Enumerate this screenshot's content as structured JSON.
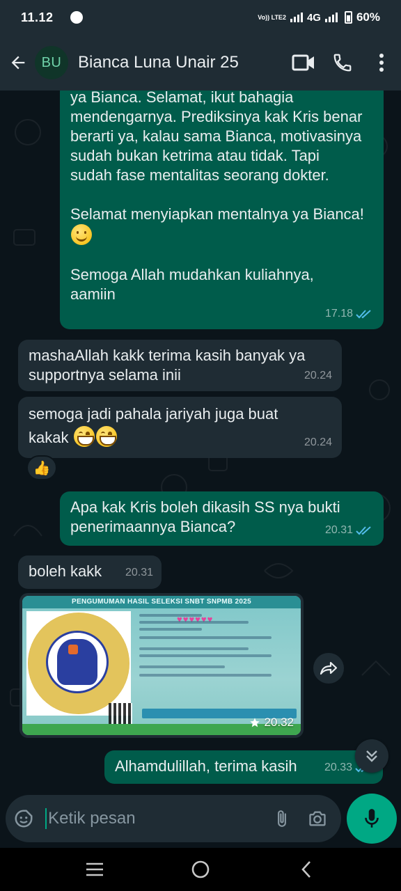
{
  "status_bar": {
    "time": "11.12",
    "volte": "Vo)) LTE2",
    "network": "4G",
    "battery": "60%"
  },
  "header": {
    "avatar_initials": "BU",
    "contact_name": "Bianca Luna Unair 25"
  },
  "messages": [
    {
      "direction": "out",
      "paragraphs": [
        "ya Bianca. Selamat, ikut bahagia mendengarnya. Prediksinya kak Kris benar berarti ya, kalau sama Bianca, motivasinya sudah bukan ketrima atau tidak. Tapi sudah fase mentalitas seorang dokter.",
        "Selamat menyiapkan mentalnya ya Bianca!",
        "Semoga Allah mudahkan kuliahnya, aamiin"
      ],
      "time": "17.18"
    },
    {
      "direction": "in",
      "text": "mashaAllah kakk terima kasih banyak ya supportnya selama inii",
      "time": "20.24"
    },
    {
      "direction": "in",
      "text": "semoga jadi pahala jariyah juga buat kakak",
      "time": "20.24",
      "reaction": "👍"
    },
    {
      "direction": "out",
      "text": "Apa kak Kris boleh dikasih SS nya bukti penerimaannya Bianca?",
      "time": "20.31"
    },
    {
      "direction": "in",
      "text": "boleh kakk",
      "time": "20.31"
    },
    {
      "direction": "in",
      "type": "image",
      "image_title": "PENGUMUMAN HASIL SELEKSI SNBT SNPMB 2025",
      "time": "20.32",
      "starred": true
    },
    {
      "direction": "out",
      "text": "Alhamdulillah, terima kasih",
      "time": "20.33"
    }
  ],
  "composer": {
    "placeholder": "Ketik pesan"
  },
  "colors": {
    "outgoing_bubble": "#005c4b",
    "incoming_bubble": "#1f2c34",
    "accent": "#00a884",
    "background": "#0b141a",
    "read_ticks": "#53bdeb"
  },
  "icons": [
    "back-arrow-icon",
    "video-call-icon",
    "voice-call-icon",
    "more-options-icon",
    "emoji-sticker-icon",
    "attach-icon",
    "camera-icon",
    "mic-icon",
    "forward-icon",
    "scroll-down-icon",
    "nav-menu-icon",
    "nav-home-icon",
    "nav-back-icon",
    "star-icon",
    "double-check-icon"
  ]
}
